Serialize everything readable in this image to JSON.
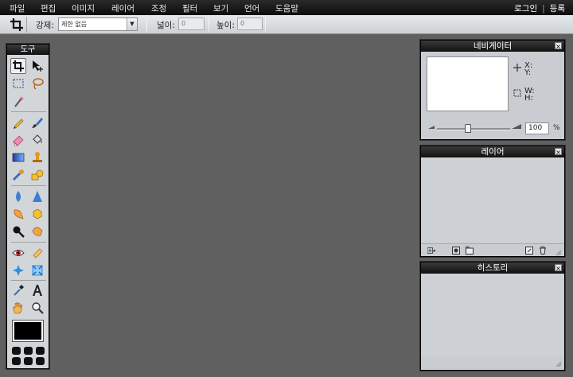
{
  "menu": {
    "items": [
      "파일",
      "편집",
      "이미지",
      "레이어",
      "조정",
      "필터",
      "보기",
      "언어",
      "도움말"
    ],
    "login": "로그인",
    "separator": "|",
    "register": "등록"
  },
  "options": {
    "constrain_label": "강제:",
    "constrain_value": "제한 없음",
    "width_label": "넓이:",
    "width_value": "0",
    "height_label": "높이:",
    "height_value": "0"
  },
  "tools_panel": {
    "title": "도구",
    "foreground_color": "#000000"
  },
  "navigator": {
    "title": "네비게이터",
    "x_label": "X:",
    "y_label": "Y:",
    "w_label": "W:",
    "h_label": "H:",
    "zoom_value": "100",
    "zoom_unit": "%",
    "zoom_level": 0.42
  },
  "layers": {
    "title": "레이어"
  },
  "history": {
    "title": "히스토리"
  },
  "colors": {
    "workspace": "#606060",
    "menubar": "#141414",
    "panel_bg": "#c9cdd1"
  },
  "icons": {
    "tools": [
      "crop-icon",
      "move-icon",
      "marquee-icon",
      "lasso-icon",
      "magic-wand-icon",
      "pencil-icon",
      "brush-icon",
      "eraser-icon",
      "paint-bucket-icon",
      "gradient-icon",
      "clone-stamp-icon",
      "color-replace-icon",
      "drawing-icon",
      "blur-icon",
      "sharpen-icon",
      "smudge-icon",
      "sponge-icon",
      "dodge-icon",
      "burn-icon",
      "red-eye-icon",
      "spot-heal-icon",
      "bloat-icon",
      "pinch-icon",
      "color-picker-icon",
      "type-icon",
      "hand-icon",
      "zoom-icon"
    ]
  }
}
